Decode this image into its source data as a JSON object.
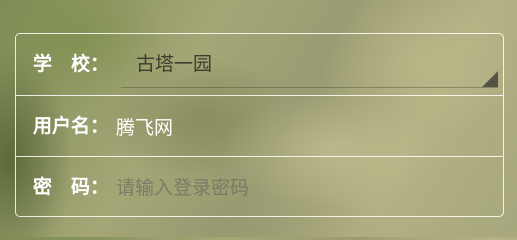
{
  "form": {
    "school": {
      "label": "学　校：",
      "selected": "古塔一园",
      "arrow_icon": "select-corner-triangle-icon"
    },
    "username": {
      "label": "用户名：",
      "value": "腾飞网"
    },
    "password": {
      "label": "密　码：",
      "value": "",
      "placeholder": "请输入登录密码"
    }
  },
  "colors": {
    "border": "#ffffff",
    "label": "#ffffff",
    "select_text": "#3d3d30",
    "placeholder": "#8a8a74"
  }
}
